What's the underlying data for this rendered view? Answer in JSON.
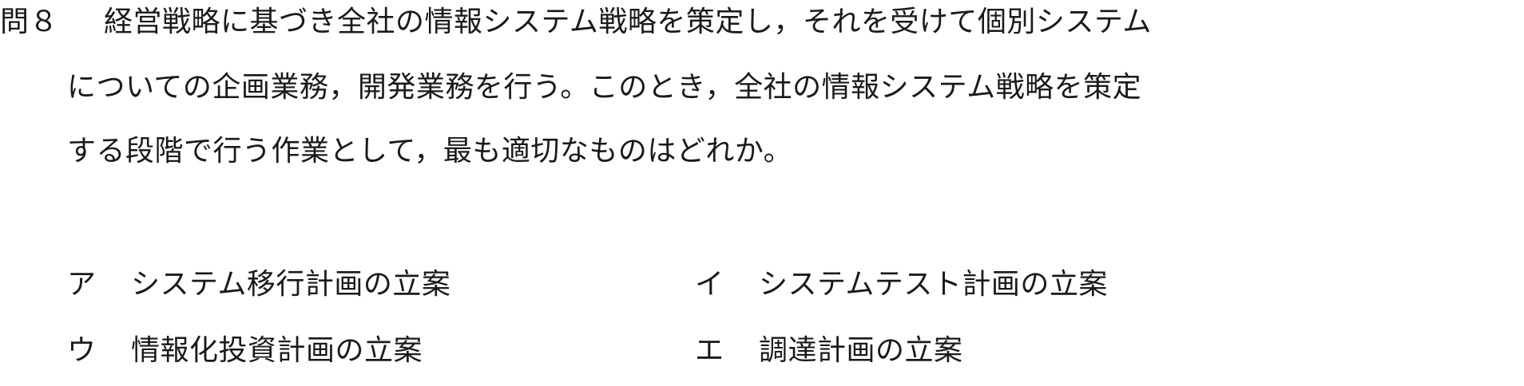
{
  "question": {
    "number": "問８",
    "lines": [
      "経営戦略に基づき全社の情報システム戦略を策定し，それを受けて個別システム",
      "についての企画業務，開発業務を行う。このとき，全社の情報システム戦略を策定",
      "する段階で行う作業として，最も適切なものはどれか。"
    ]
  },
  "choices": [
    {
      "mark": "ア",
      "text": "システム移行計画の立案"
    },
    {
      "mark": "イ",
      "text": "システムテスト計画の立案"
    },
    {
      "mark": "ウ",
      "text": "情報化投資計画の立案"
    },
    {
      "mark": "エ",
      "text": "調達計画の立案"
    }
  ]
}
